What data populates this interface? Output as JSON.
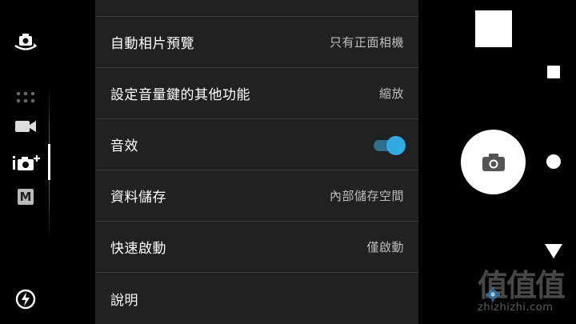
{
  "settings": {
    "rows": [
      {
        "label": "",
        "value": ""
      },
      {
        "label": "自動相片預覽",
        "value": "只有正面相機"
      },
      {
        "label": "設定音量鍵的其他功能",
        "value": "縮放"
      },
      {
        "label": "音效",
        "toggle_on": true
      },
      {
        "label": "資料儲存",
        "value": "內部儲存空間"
      },
      {
        "label": "快速啟動",
        "value": "僅啟動"
      },
      {
        "label": "說明",
        "value": ""
      }
    ]
  },
  "left_rail": {
    "icons": [
      "switch-camera-icon",
      "more-apps-icon",
      "video-mode-icon",
      "superior-auto-icon",
      "manual-mode-icon",
      "flash-auto-icon"
    ],
    "manual_label": "M"
  },
  "right_rail": {
    "icons": [
      "photo-thumbnail",
      "shutter-camera-icon",
      "recent-apps-icon",
      "home-icon",
      "back-icon"
    ]
  },
  "watermark": {
    "glyphs": "值值值",
    "url": "zhizhizhi.com"
  },
  "colors": {
    "panel_bg": "#212121",
    "divider": "#383838",
    "accent": "#33a9e2",
    "value_text": "#bdbdbd"
  }
}
